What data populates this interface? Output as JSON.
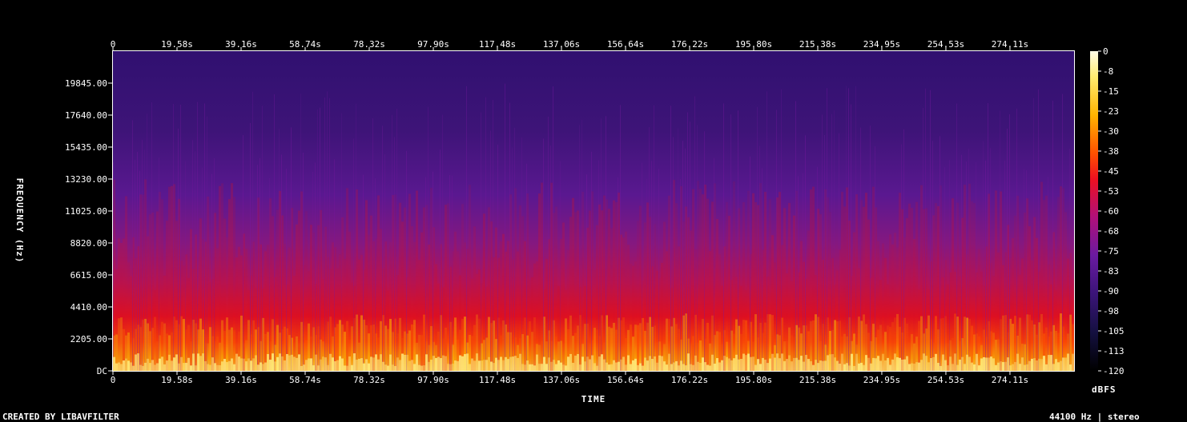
{
  "chart_data": {
    "type": "heatmap",
    "title": "",
    "xlabel": "TIME",
    "ylabel": "FREQUENCY (Hz)",
    "colorbar_label": "dBFS",
    "x_ticks": [
      "0",
      "19.58s",
      "39.16s",
      "58.74s",
      "78.32s",
      "97.90s",
      "117.48s",
      "137.06s",
      "156.64s",
      "176.22s",
      "195.80s",
      "215.38s",
      "234.95s",
      "254.53s",
      "274.11s"
    ],
    "x_tick_values": [
      0,
      19.58,
      39.16,
      58.74,
      78.32,
      97.9,
      117.48,
      137.06,
      156.64,
      176.22,
      195.8,
      215.38,
      234.95,
      254.53,
      274.11
    ],
    "xlim": [
      0,
      293.7
    ],
    "y_ticks": [
      "DC",
      "2205.00",
      "4410.00",
      "6615.00",
      "8820.00",
      "11025.00",
      "13230.00",
      "15435.00",
      "17640.00",
      "19845.00"
    ],
    "y_tick_values": [
      0,
      2205,
      4410,
      6615,
      8820,
      11025,
      13230,
      15435,
      17640,
      19845
    ],
    "ylim": [
      0,
      22050
    ],
    "colorbar_ticks": [
      "0",
      "-8",
      "-15",
      "-23",
      "-30",
      "-38",
      "-45",
      "-53",
      "-60",
      "-68",
      "-75",
      "-83",
      "-90",
      "-98",
      "-105",
      "-113",
      "-120"
    ],
    "colorbar_range": [
      -120,
      0
    ],
    "colormap": "intensity",
    "colors": {
      "background": "#000000",
      "high": "#fff8a0",
      "mid_high": "#ffb000",
      "mid": "#ff2a00",
      "mid_low": "#7a18a0",
      "low": "#32106a",
      "floor": "#000000"
    }
  },
  "footer": {
    "left": "CREATED BY LIBAVFILTER",
    "right": "44100 Hz | stereo"
  }
}
